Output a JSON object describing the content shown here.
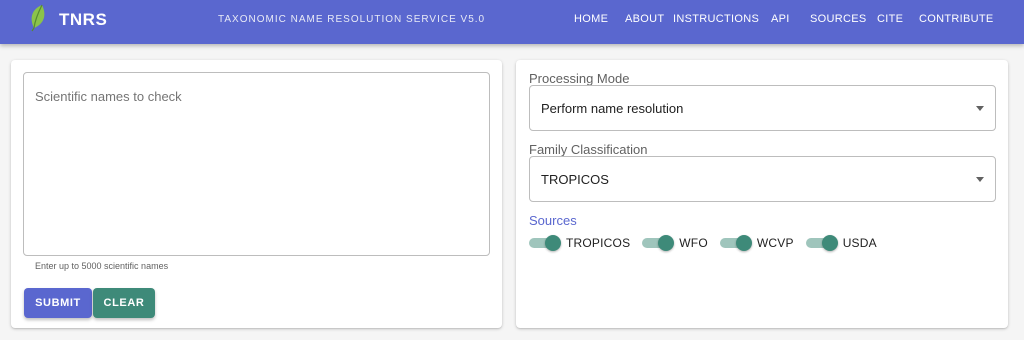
{
  "header": {
    "brand": "TNRS",
    "subtitle": "TAXONOMIC NAME RESOLUTION SERVICE V5.0",
    "logo_icon": "leaf-icon",
    "nav": [
      {
        "label": "HOME"
      },
      {
        "label": "ABOUT"
      },
      {
        "label": "INSTRUCTIONS"
      },
      {
        "label": "API"
      },
      {
        "label": "SOURCES"
      },
      {
        "label": "CITE"
      },
      {
        "label": "CONTRIBUTE"
      }
    ]
  },
  "input": {
    "placeholder": "Scientific names to check",
    "value": "",
    "helper": "Enter up to 5000 scientific names"
  },
  "buttons": {
    "submit": "SUBMIT",
    "clear": "CLEAR"
  },
  "options": {
    "processing_mode": {
      "label": "Processing Mode",
      "value": "Perform name resolution"
    },
    "family_classification": {
      "label": "Family Classification",
      "value": "TROPICOS"
    },
    "sources_label": "Sources",
    "sources": [
      {
        "label": "TROPICOS",
        "checked": true
      },
      {
        "label": "WFO",
        "checked": true
      },
      {
        "label": "WCVP",
        "checked": true
      },
      {
        "label": "USDA",
        "checked": true
      }
    ]
  },
  "colors": {
    "primary": "#5a67cf",
    "secondary": "#3e8a79",
    "secondary_light": "#9fc5bc",
    "leaf": "#8bc34a"
  }
}
